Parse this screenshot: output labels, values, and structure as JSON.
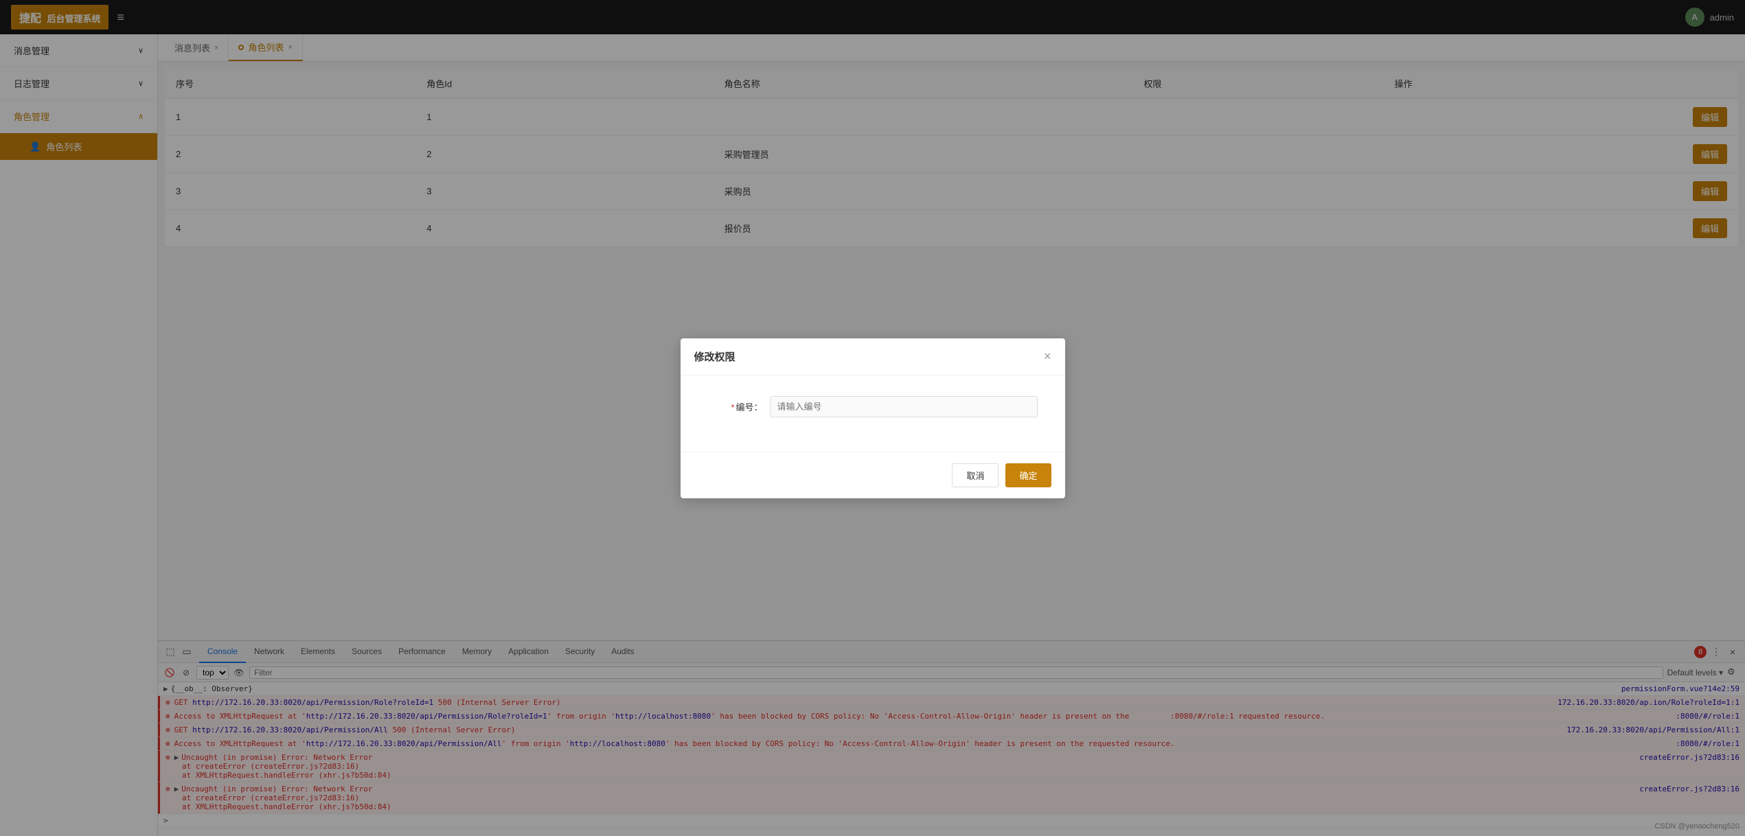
{
  "header": {
    "logo": "捷配",
    "system_name": "后台管理系统",
    "hamburger_icon": "≡",
    "admin_label": "admin"
  },
  "sidebar": {
    "items": [
      {
        "id": "news-mgmt",
        "label": "消息管理",
        "expanded": false,
        "active": false
      },
      {
        "id": "log-mgmt",
        "label": "日志管理",
        "expanded": false,
        "active": false
      },
      {
        "id": "role-mgmt",
        "label": "角色管理",
        "expanded": true,
        "active": true,
        "children": [
          {
            "id": "role-list",
            "label": "角色列表",
            "active": true
          }
        ]
      }
    ]
  },
  "tabs": [
    {
      "id": "news-list",
      "label": "消息列表",
      "active": false,
      "closable": true,
      "dot": false
    },
    {
      "id": "role-list",
      "label": "角色列表",
      "active": true,
      "closable": true,
      "dot": true
    }
  ],
  "table": {
    "columns": [
      "序号",
      "角色Id",
      "角色名称",
      "权限",
      "操作"
    ],
    "rows": [
      {
        "seq": "1",
        "id": "1",
        "name": "",
        "perms": "",
        "ops": "编辑"
      },
      {
        "seq": "2",
        "id": "2",
        "name": "采购管理员",
        "perms": "",
        "ops": "编辑"
      },
      {
        "seq": "3",
        "id": "3",
        "name": "采购员",
        "perms": "",
        "ops": "编辑"
      },
      {
        "seq": "4",
        "id": "4",
        "name": "报价员",
        "perms": "",
        "ops": "编辑"
      }
    ]
  },
  "modal": {
    "title": "修改权限",
    "fields": [
      {
        "label": "编号：",
        "placeholder": "请输入编号",
        "required": true
      }
    ],
    "buttons": {
      "cancel": "取消",
      "confirm": "确定"
    }
  },
  "devtools": {
    "tabs": [
      "Console",
      "Network",
      "Elements",
      "Sources",
      "Performance",
      "Memory",
      "Application",
      "Security",
      "Audits"
    ],
    "active_tab": "Console",
    "error_count": "8",
    "console_toolbar": {
      "top_label": "top",
      "filter_placeholder": "Filter",
      "default_levels": "Default levels ▾"
    },
    "log_entries": [
      {
        "type": "plain",
        "expand": true,
        "text": "▶ {__ob__: Observer}",
        "source": "permissionForm.vue?14e2:59"
      },
      {
        "type": "error",
        "text": "GET http://172.16.20.33:8020/api/Permission/Role?roleId=1 500 (Internal Server Error)",
        "source": "172.16.20.33:8020/ap.ion/Role?roleId=1:1"
      },
      {
        "type": "error",
        "text": "Access to XMLHttpRequest at 'http://172.16.20.33:8020/api/Permission/Role?roleId=1' from origin 'http://localhost:8080' has been blocked by CORS policy: No 'Access-Control-Allow-Origin' header is present on the requested resource.",
        "source": ":8080/#/role:1"
      },
      {
        "type": "error",
        "text": "GET http://172.16.20.33:8020/api/Permission/All 500 (Internal Server Error)",
        "source": "172.16.20.33:8020/api/Permission/All:1"
      },
      {
        "type": "error",
        "text": "Access to XMLHttpRequest at 'http://172.16.20.33:8020/api/Permission/All' from origin 'http://localhost:8080' has been blocked by CORS policy: No 'Access-Control-Allow-Origin' header is present on the requested resource.",
        "source": ":8080/#/role:1"
      },
      {
        "type": "error",
        "expand": true,
        "text": "Uncaught (in promise) Error: Network Error",
        "sub1": "at createError (createError.js?2d83:16)",
        "sub2": "at XMLHttpRequest.handleError (xhr.js?b50d:84)",
        "source": "createError.js?2d83:16"
      },
      {
        "type": "error",
        "expand": true,
        "text": "▶ Uncaught (in promise) Error: Network Error",
        "sub1": "at createError (createError.js?2d83:16)",
        "sub2": "at XMLHttpRequest.handleError (xhr.js?b50d:84)",
        "source": "createError.js?2d83:16"
      }
    ]
  },
  "watermark": "CSDN @yenaocheng520"
}
